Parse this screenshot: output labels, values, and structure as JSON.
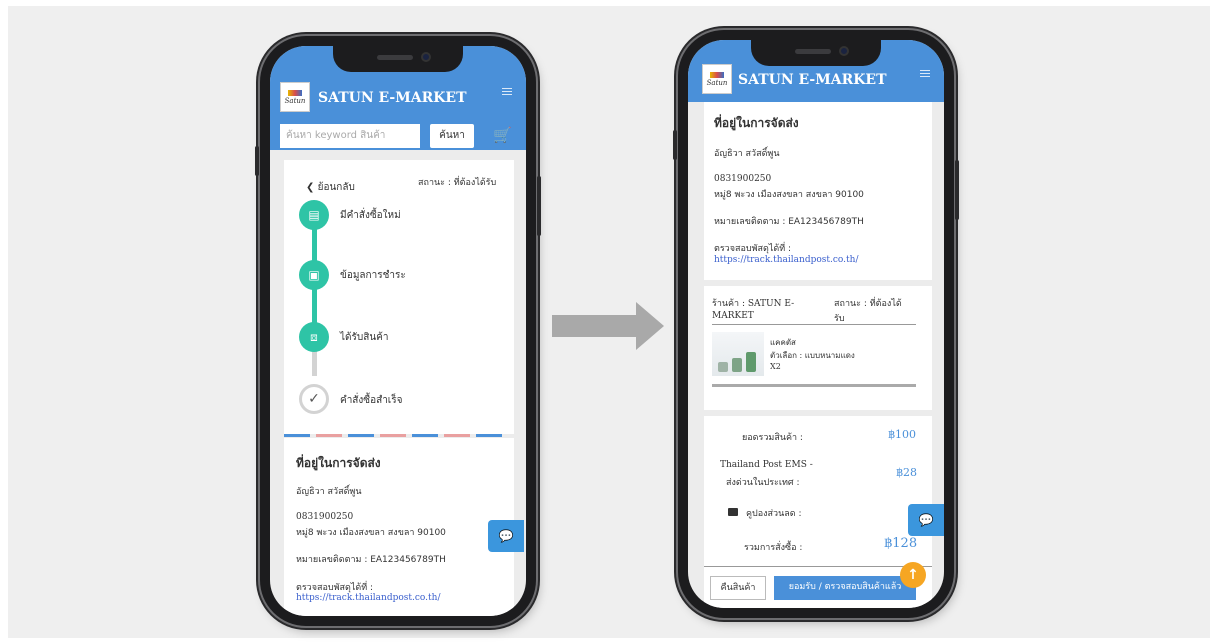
{
  "app": {
    "brand": "SATUN E-MARKET",
    "logo_text": "Satun"
  },
  "search": {
    "placeholder": "ค้นหา keyword สินค้า",
    "button": "ค้นหา",
    "cart_icon": "cart-icon"
  },
  "left": {
    "back": "ย้อนกลับ",
    "status": "สถานะ : ที่ต้องได้รับ",
    "steps": [
      {
        "label": "มีคำสั่งซื้อใหม่",
        "icon": "receipt-icon"
      },
      {
        "label": "ข้อมูลการชำระ",
        "icon": "money-icon"
      },
      {
        "label": "ได้รับสินค้า",
        "icon": "box-icon"
      },
      {
        "label": "คำสั่งซื้อสำเร็จ",
        "icon": "check-icon"
      }
    ],
    "address": {
      "title": "ที่อยู่ในการจัดส่ง",
      "name": "อัญธิวา สวัสดิ์พูน",
      "phone": "0831900250",
      "address": "หมู่8 พะวง เมืองสงขลา สงขลา 90100",
      "tracking": "หมายเลขติดตาม : EA123456789TH",
      "check_label": "ตรวจสอบพัสดุได้ที่ :",
      "check_url": "https://track.thailandpost.co.th/"
    }
  },
  "right": {
    "address": {
      "title": "ที่อยู่ในการจัดส่ง",
      "name": "อัญธิวา สวัสดิ์พูน",
      "phone": "0831900250",
      "address": "หมู่8 พะวง เมืองสงขลา สงขลา 90100",
      "tracking": "หมายเลขติดตาม : EA123456789TH",
      "check_label": "ตรวจสอบพัสดุได้ที่ :",
      "check_url": "https://track.thailandpost.co.th/"
    },
    "shop_line1": "ร้านค้า : SATUN E-",
    "shop_line2": "MARKET",
    "status_line1": "สถานะ : ที่ต้องได้",
    "status_line2": "รับ",
    "product": {
      "name": "แคคตัส",
      "option": "ตัวเลือก : แบบหนามแดง",
      "qty": "X2"
    },
    "summary": {
      "subtotal_label": "ยอดรวมสินค้า :",
      "subtotal": "฿100",
      "shipping_label1": "Thailand Post EMS -",
      "shipping_label2": "ส่งด่วนในประเทศ :",
      "shipping": "฿28",
      "coupon_label": "คูปองส่วนลด :",
      "total_label": "รวมการสั่งซื้อ :",
      "total": "฿128"
    },
    "buttons": {
      "return": "คืนสินค้า",
      "confirm": "ยอมรับ / ตรวจสอบสินค้าแล้ว"
    }
  },
  "colors": {
    "header": "#4a90d9",
    "step": "#2ec4a6",
    "fab_orange": "#f6a623"
  }
}
